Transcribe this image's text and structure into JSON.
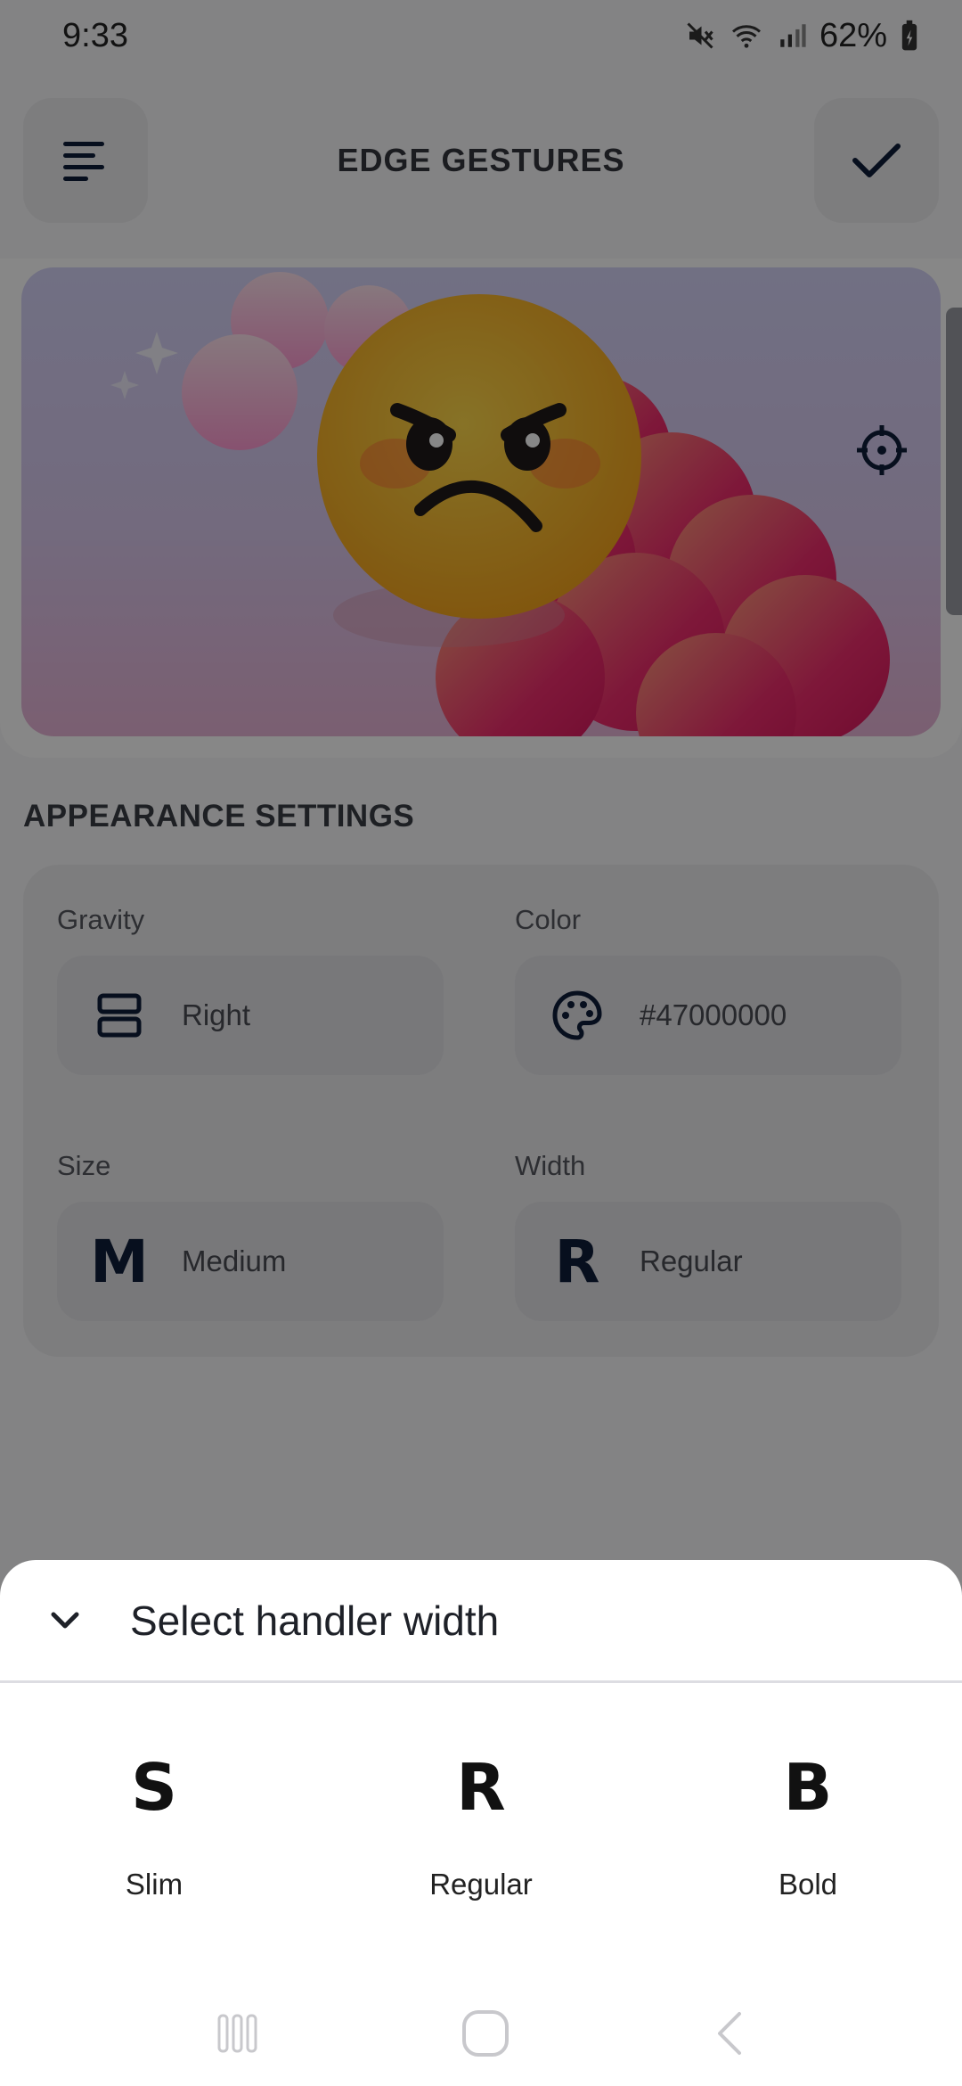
{
  "status_bar": {
    "time": "9:33",
    "battery": "62%"
  },
  "top_bar": {
    "title": "EDGE GESTURES"
  },
  "appearance": {
    "section_title": "APPEARANCE SETTINGS",
    "gravity": {
      "label": "Gravity",
      "value": "Right"
    },
    "color": {
      "label": "Color",
      "value": "#47000000"
    },
    "size": {
      "label": "Size",
      "value": "Medium",
      "letter": "M"
    },
    "width": {
      "label": "Width",
      "value": "Regular",
      "letter": "R"
    }
  },
  "sheet": {
    "title": "Select handler width",
    "options": [
      {
        "letter": "S",
        "label": "Slim"
      },
      {
        "letter": "R",
        "label": "Regular"
      },
      {
        "letter": "B",
        "label": "Bold"
      }
    ]
  },
  "colors": {
    "accent_navy": "#0f1e3a",
    "scrim": "rgba(0,0,0,0.47)"
  }
}
